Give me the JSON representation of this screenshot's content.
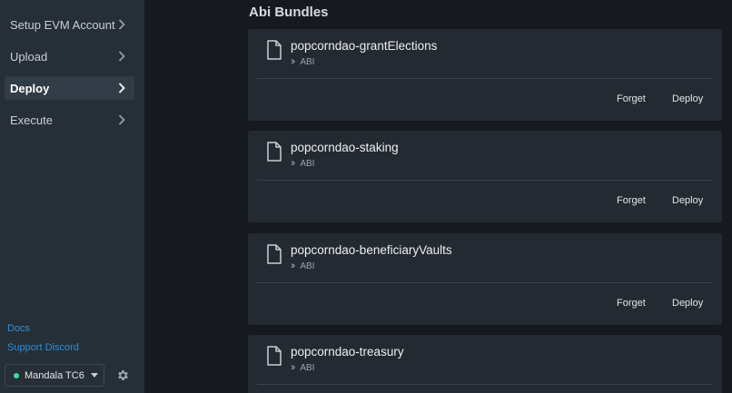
{
  "sidebar": {
    "items": [
      {
        "label": "Setup EVM Account",
        "active": false
      },
      {
        "label": "Upload",
        "active": false
      },
      {
        "label": "Deploy",
        "active": true
      },
      {
        "label": "Execute",
        "active": false
      }
    ],
    "links": {
      "docs": "Docs",
      "support": "Support Discord"
    },
    "network": {
      "label": "Mandala TC6",
      "status_color": "#3ddc97"
    }
  },
  "main": {
    "title": "Abi Bundles",
    "bundles": [
      {
        "name": "popcorndao-grantElections",
        "type": "ABI",
        "forget_label": "Forget",
        "deploy_label": "Deploy"
      },
      {
        "name": "popcorndao-staking",
        "type": "ABI",
        "forget_label": "Forget",
        "deploy_label": "Deploy"
      },
      {
        "name": "popcorndao-beneficiaryVaults",
        "type": "ABI",
        "forget_label": "Forget",
        "deploy_label": "Deploy"
      },
      {
        "name": "popcorndao-treasury",
        "type": "ABI",
        "forget_label": "Forget",
        "deploy_label": "Deploy"
      }
    ]
  },
  "colors": {
    "link": "#2f8fd8",
    "sidebar_bg": "#262f37",
    "card_bg": "#242a31",
    "active_item_bg": "#323c46"
  },
  "icons": {
    "nav": "chevron-right-icon",
    "bundle": "file-icon",
    "sub": "double-chevron-icon",
    "settings": "gear-icon"
  }
}
